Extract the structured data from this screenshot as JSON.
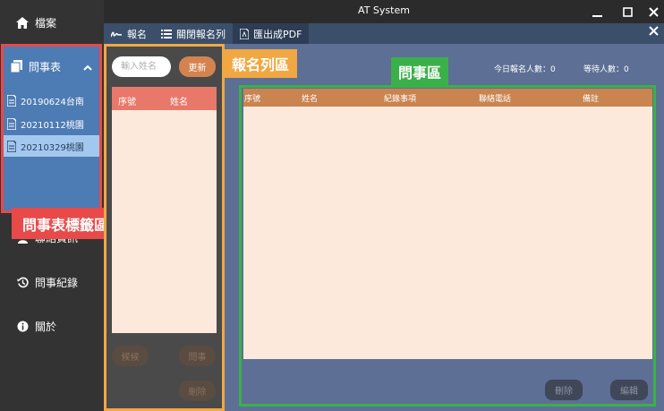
{
  "window": {
    "title": "AT System",
    "controls": [
      "minimize",
      "maximize",
      "close"
    ]
  },
  "sidebar": {
    "items": [
      {
        "label": "檔案",
        "icon": "home-icon"
      },
      {
        "label": "問事表",
        "icon": "document-stack-icon",
        "expanded": true
      },
      {
        "label": "聯絡資訊",
        "icon": "contact-icon"
      },
      {
        "label": "問事紀錄",
        "icon": "history-icon"
      },
      {
        "label": "關於",
        "icon": "info-icon"
      }
    ],
    "sub_items": [
      {
        "label": "20190624台南",
        "icon": "file-icon"
      },
      {
        "label": "20210112桃園",
        "icon": "file-icon"
      },
      {
        "label": "20210329桃園",
        "icon": "file-icon",
        "selected": true
      }
    ]
  },
  "menubar": {
    "items": [
      {
        "label": "報名",
        "icon": "signature-icon"
      },
      {
        "label": "關閉報名列",
        "icon": "list-icon"
      },
      {
        "label": "匯出成PDF",
        "icon": "pdf-icon"
      }
    ]
  },
  "registration": {
    "search_placeholder": "輸入姓名",
    "refresh_label": "更新",
    "columns": [
      "序號",
      "姓名"
    ],
    "rows": [],
    "buttons": {
      "late": "候候",
      "ask": "問事",
      "delete": "刪除"
    }
  },
  "consultation": {
    "today_count_label": "今日報名人數：0",
    "waiting_count_label": "等待人數：0",
    "columns": [
      "序號",
      "姓名",
      "紀錄事項",
      "聯絡電話",
      "備註"
    ],
    "rows": [],
    "buttons": {
      "delete": "刪除",
      "edit": "編輯"
    }
  },
  "annotations": {
    "sidebar_region": "問事表標籤區",
    "registration_region": "報名列區",
    "consultation_region": "問事區"
  },
  "colors": {
    "annotation_red": "#e84a4a",
    "annotation_orange": "#f0a843",
    "annotation_green": "#3bb04a",
    "sidebar_panel": "#4d7bb3",
    "table_bg": "#fde9db"
  }
}
